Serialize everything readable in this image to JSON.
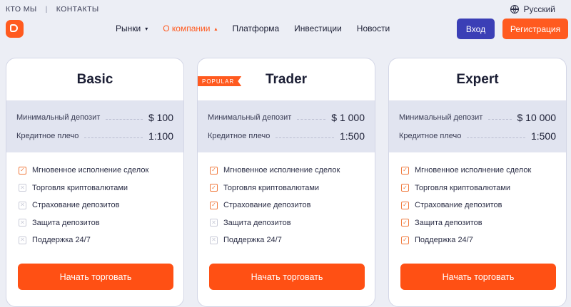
{
  "header": {
    "top_links": [
      "КТО МЫ",
      "КОНТАКТЫ"
    ],
    "separator": "|",
    "language": "Русский",
    "nav": [
      {
        "label": "Рынки",
        "chevron": "▾",
        "active": false
      },
      {
        "label": "О компании",
        "chevron": "▴",
        "active": true
      },
      {
        "label": "Платформа",
        "chevron": "",
        "active": false
      },
      {
        "label": "Инвестиции",
        "chevron": "",
        "active": false
      },
      {
        "label": "Новости",
        "chevron": "",
        "active": false
      }
    ],
    "login_label": "Вход",
    "register_label": "Регистрация"
  },
  "plans": [
    {
      "name": "Basic",
      "deposit_label": "Минимальный депозит",
      "deposit_value": "$ 100",
      "leverage_label": "Кредитное плечо",
      "leverage_value": "1:100",
      "features": [
        {
          "label": "Мгновенное исполнение сделок",
          "included": true
        },
        {
          "label": "Торговля криптовалютами",
          "included": false
        },
        {
          "label": "Страхование депозитов",
          "included": false
        },
        {
          "label": "Защита депозитов",
          "included": false
        },
        {
          "label": "Поддержка 24/7",
          "included": false
        }
      ],
      "cta": "Начать торговать"
    },
    {
      "name": "Trader",
      "badge": "POPULAR",
      "deposit_label": "Минимальный депозит",
      "deposit_value": "$ 1 000",
      "leverage_label": "Кредитное плечо",
      "leverage_value": "1:500",
      "features": [
        {
          "label": "Мгновенное исполнение сделок",
          "included": true
        },
        {
          "label": "Торговля криптовалютами",
          "included": true
        },
        {
          "label": "Страхование депозитов",
          "included": true
        },
        {
          "label": "Защита депозитов",
          "included": false
        },
        {
          "label": "Поддержка 24/7",
          "included": false
        }
      ],
      "cta": "Начать торговать"
    },
    {
      "name": "Expert",
      "deposit_label": "Минимальный депозит",
      "deposit_value": "$ 10 000",
      "leverage_label": "Кредитное плечо",
      "leverage_value": "1:500",
      "features": [
        {
          "label": "Мгновенное исполнение сделок",
          "included": true
        },
        {
          "label": "Торговля криптовалютами",
          "included": true
        },
        {
          "label": "Страхование депозитов",
          "included": true
        },
        {
          "label": "Защита депозитов",
          "included": true
        },
        {
          "label": "Поддержка 24/7",
          "included": true
        }
      ],
      "cta": "Начать торговать"
    }
  ],
  "colors": {
    "accent": "#ff5a1f",
    "login": "#3b3fb6",
    "check": "#f07a3e",
    "cross": "#c9cbd8"
  },
  "icons": {
    "check": "✓",
    "cross": "✕"
  }
}
